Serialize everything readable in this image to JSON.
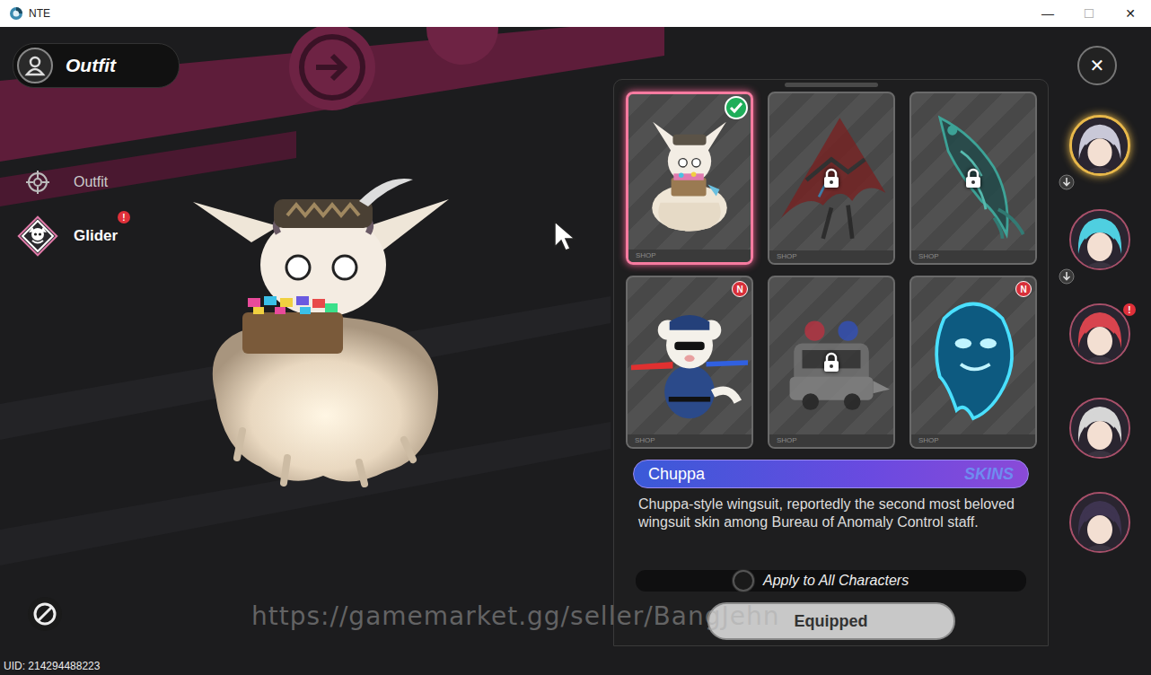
{
  "window": {
    "title": "NTE",
    "controls": [
      "—",
      "☐",
      "✕"
    ]
  },
  "header": {
    "title": "Outfit"
  },
  "alert_badge": "!",
  "new_badge": "N",
  "menu": [
    {
      "label": "Outfit",
      "kind": "crosshair",
      "selected": false,
      "alert": false
    },
    {
      "label": "Glider",
      "kind": "glider",
      "selected": true,
      "alert": true
    }
  ],
  "items": [
    {
      "kind": "chuppa",
      "tag": "SHOP",
      "selected": true,
      "equipped": true,
      "locked": false,
      "new": false
    },
    {
      "kind": "kite",
      "tag": "SHOP",
      "selected": false,
      "equipped": false,
      "locked": true,
      "new": false
    },
    {
      "kind": "fish",
      "tag": "SHOP",
      "selected": false,
      "equipped": false,
      "locked": true,
      "new": false
    },
    {
      "kind": "police",
      "tag": "SHOP",
      "selected": false,
      "equipped": false,
      "locked": false,
      "new": true
    },
    {
      "kind": "car",
      "tag": "SHOP",
      "selected": false,
      "equipped": false,
      "locked": true,
      "new": false
    },
    {
      "kind": "ghost",
      "tag": "SHOP",
      "selected": false,
      "equipped": false,
      "locked": false,
      "new": true
    }
  ],
  "selected_item": {
    "name": "Chuppa",
    "category": "SKINS",
    "description": "Chuppa-style wingsuit, reportedly the second most beloved wingsuit skin among Bureau of Anomaly Control staff."
  },
  "apply_all": {
    "label": "Apply to All Characters",
    "on": false
  },
  "button": {
    "label": "Equipped"
  },
  "close": "✕",
  "characters": [
    {
      "color": "#c9c8d8",
      "selected": true,
      "download": true,
      "alert": false
    },
    {
      "color": "#4fcfe0",
      "selected": false,
      "download": true,
      "alert": false
    },
    {
      "color": "#d8444e",
      "selected": false,
      "download": false,
      "alert": true
    },
    {
      "color": "#d6d6d6",
      "selected": false,
      "download": false,
      "alert": false
    },
    {
      "color": "#3e3450",
      "selected": false,
      "download": false,
      "alert": false
    }
  ],
  "uid": "UID: 214294488223",
  "watermark": "https://gamemarket.gg/seller/BangJehn"
}
